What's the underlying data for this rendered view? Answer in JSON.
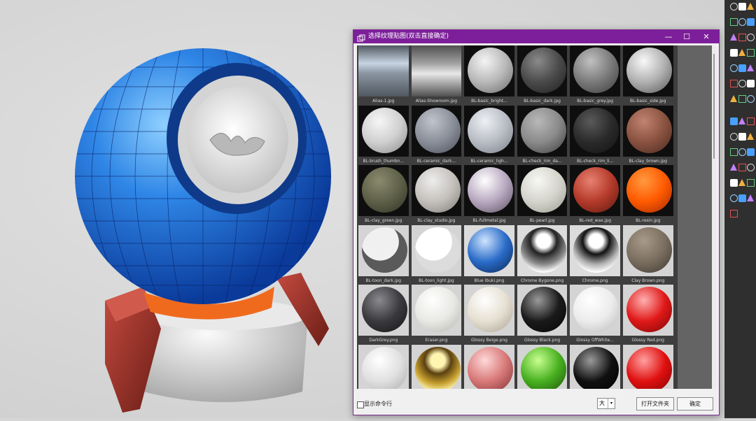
{
  "dialog": {
    "title": "选择纹理贴图(双击直接确定)",
    "window_buttons": {
      "minimize": "—",
      "maximize": "☐",
      "close": "✕"
    },
    "show_command_line_label": "显示命令行",
    "show_command_line_checked": false,
    "size_value": "大",
    "size_arrow": "▾",
    "open_folder_label": "打开文件夹",
    "ok_label": "确定"
  },
  "textures": [
    {
      "name": "Alias-1.jpg",
      "kind": "env",
      "c": [
        "#c8d4e2",
        "#8a94a0",
        "#505860"
      ]
    },
    {
      "name": "Alias-Showroom.jpg",
      "kind": "env",
      "c": [
        "#a0a0a0",
        "#e8e8e8",
        "#505050"
      ]
    },
    {
      "name": "BL-basic_bright...",
      "kind": "ball",
      "c": [
        "#f4f4f4",
        "#b8b8b8",
        "#6a6a6a"
      ]
    },
    {
      "name": "BL-basic_dark.jpg",
      "kind": "ball",
      "c": [
        "#8a8a8a",
        "#4a4a4a",
        "#1e1e1e"
      ]
    },
    {
      "name": "BL-basic_grey.jpg",
      "kind": "ball",
      "c": [
        "#c0c0c0",
        "#7a7a7a",
        "#3a3a3a"
      ]
    },
    {
      "name": "BL-basic_side.jpg",
      "kind": "ball",
      "c": [
        "#f8f8f8",
        "#b0b0b0",
        "#555555"
      ]
    },
    {
      "name": "BL-brush_thumbn...",
      "kind": "ball",
      "c": [
        "#f6f6f6",
        "#d0d0d0",
        "#8a8a8a"
      ]
    },
    {
      "name": "BL-ceramic_dark...",
      "kind": "ball",
      "c": [
        "#c0c4cc",
        "#8a8e98",
        "#4a4e58"
      ]
    },
    {
      "name": "BL-ceramic_ligh...",
      "kind": "ball",
      "c": [
        "#eef0f4",
        "#b8bcc4",
        "#7a7e88"
      ]
    },
    {
      "name": "BL-check_rim_da...",
      "kind": "ball",
      "c": [
        "#b8b8b8",
        "#8a8a8a",
        "#3c3c3c"
      ]
    },
    {
      "name": "BL-check_rim_li...",
      "kind": "ball",
      "c": [
        "#5a5a5a",
        "#2a2a2a",
        "#121212"
      ]
    },
    {
      "name": "BL-clay_brown.jpg",
      "kind": "ball",
      "c": [
        "#c08470",
        "#8a5240",
        "#4a2a20"
      ]
    },
    {
      "name": "BL-clay_green.jpg",
      "kind": "ball",
      "c": [
        "#8a8a6e",
        "#5e6048",
        "#303224"
      ]
    },
    {
      "name": "BL-clay_studio.jpg",
      "kind": "ball",
      "c": [
        "#ededed",
        "#c4c0bc",
        "#7e7a76"
      ]
    },
    {
      "name": "BL-fullmetal.jpg",
      "kind": "ball",
      "c": [
        "#ffffff",
        "#b8a8c0",
        "#5a5060"
      ]
    },
    {
      "name": "BL-pearl.jpg",
      "kind": "ball",
      "c": [
        "#f8f8f4",
        "#d4d4cc",
        "#9a9a92"
      ]
    },
    {
      "name": "BL-red_wax.jpg",
      "kind": "ball",
      "c": [
        "#e88070",
        "#b43a2a",
        "#5a1a10"
      ]
    },
    {
      "name": "BL-resin.jpg",
      "kind": "ball",
      "c": [
        "#ff9a40",
        "#ff5a00",
        "#a02800"
      ]
    },
    {
      "name": "BL-toon_dark.jpg",
      "kind": "toon",
      "c": [
        "#f0f0f0",
        "#5a5a5a",
        "#1a1a1a"
      ]
    },
    {
      "name": "BL-toon_light.jpg",
      "kind": "toon",
      "c": [
        "#ffffff",
        "#dcdcdc",
        "#a0a0a0"
      ]
    },
    {
      "name": "Blue Ibuki.png",
      "kind": "ball",
      "c": [
        "#cfe4ff",
        "#2a6cc8",
        "#0a2450"
      ]
    },
    {
      "name": "Chrome Bygone.png",
      "kind": "chrome",
      "c": [
        "#ffffff",
        "#8a8a8a",
        "#222222"
      ]
    },
    {
      "name": "Chrome.png",
      "kind": "chrome",
      "c": [
        "#ffffff",
        "#b0b0b0",
        "#111111"
      ]
    },
    {
      "name": "Clay Brown.png",
      "kind": "ball",
      "c": [
        "#a89a88",
        "#7a6e60",
        "#3e3630"
      ]
    },
    {
      "name": "DarkGrey.png",
      "kind": "ball",
      "c": [
        "#8a8a8e",
        "#3a3a3e",
        "#141416"
      ]
    },
    {
      "name": "Eraser.png",
      "kind": "ball",
      "c": [
        "#ffffff",
        "#e8e8e4",
        "#b4b4ae"
      ]
    },
    {
      "name": "Glossy Beige.png",
      "kind": "ball",
      "c": [
        "#ffffff",
        "#e6e0d2",
        "#a8a090"
      ]
    },
    {
      "name": "Glossy Black.png",
      "kind": "ball",
      "c": [
        "#9a9a9a",
        "#1a1a1a",
        "#050505"
      ]
    },
    {
      "name": "Glossy OffWhite...",
      "kind": "ball",
      "c": [
        "#ffffff",
        "#ececec",
        "#b8b8b8"
      ]
    },
    {
      "name": "Glossy Red.png",
      "kind": "ball",
      "c": [
        "#ffb0b0",
        "#e01818",
        "#7a0808"
      ]
    },
    {
      "name": "",
      "kind": "ball",
      "c": [
        "#ffffff",
        "#e0e0e0",
        "#a8a8a8"
      ]
    },
    {
      "name": "",
      "kind": "chrome",
      "c": [
        "#fff4b0",
        "#c8a030",
        "#5a4010"
      ]
    },
    {
      "name": "",
      "kind": "ball",
      "c": [
        "#ffd8d8",
        "#d87878",
        "#7a3030"
      ]
    },
    {
      "name": "",
      "kind": "ball",
      "c": [
        "#c8ff90",
        "#48b020",
        "#1a5008"
      ]
    },
    {
      "name": "",
      "kind": "ball",
      "c": [
        "#9a9a9a",
        "#101010",
        "#000000"
      ]
    },
    {
      "name": "",
      "kind": "ball",
      "c": [
        "#ffa0a0",
        "#e01010",
        "#800404"
      ]
    }
  ],
  "colors": {
    "titlebar": "#7d1f9a",
    "thumb_bg_dark": "#111111",
    "thumb_bg_light": "#d8d8d8",
    "grid_bg": "#3e3e3e"
  },
  "toolbar_icons": [
    "circle-icon",
    "arc-icon",
    "polygon-icon",
    "ellipse-icon",
    "sphere-icon",
    "box-icon",
    "cylinder-icon",
    "cone-icon",
    "torus-icon",
    "extrude-icon",
    "revolve-icon",
    "loft-icon",
    "sweep-icon",
    "boolean-union-icon",
    "boolean-diff-icon",
    "fillet-icon",
    "chamfer-icon",
    "shell-icon",
    "explode-icon",
    "join-icon",
    "mirror-icon",
    "array-icon",
    "scale-icon",
    "rotate-icon",
    "move-icon",
    "copy-icon",
    "trim-icon",
    "split-icon",
    "offset-icon",
    "project-icon",
    "check-icon",
    "render-icon",
    "layer-icon",
    "snap-icon",
    "grid-icon",
    "ortho-icon",
    "planar-icon",
    "osnap-icon",
    "gumball-icon",
    "history-icon"
  ]
}
